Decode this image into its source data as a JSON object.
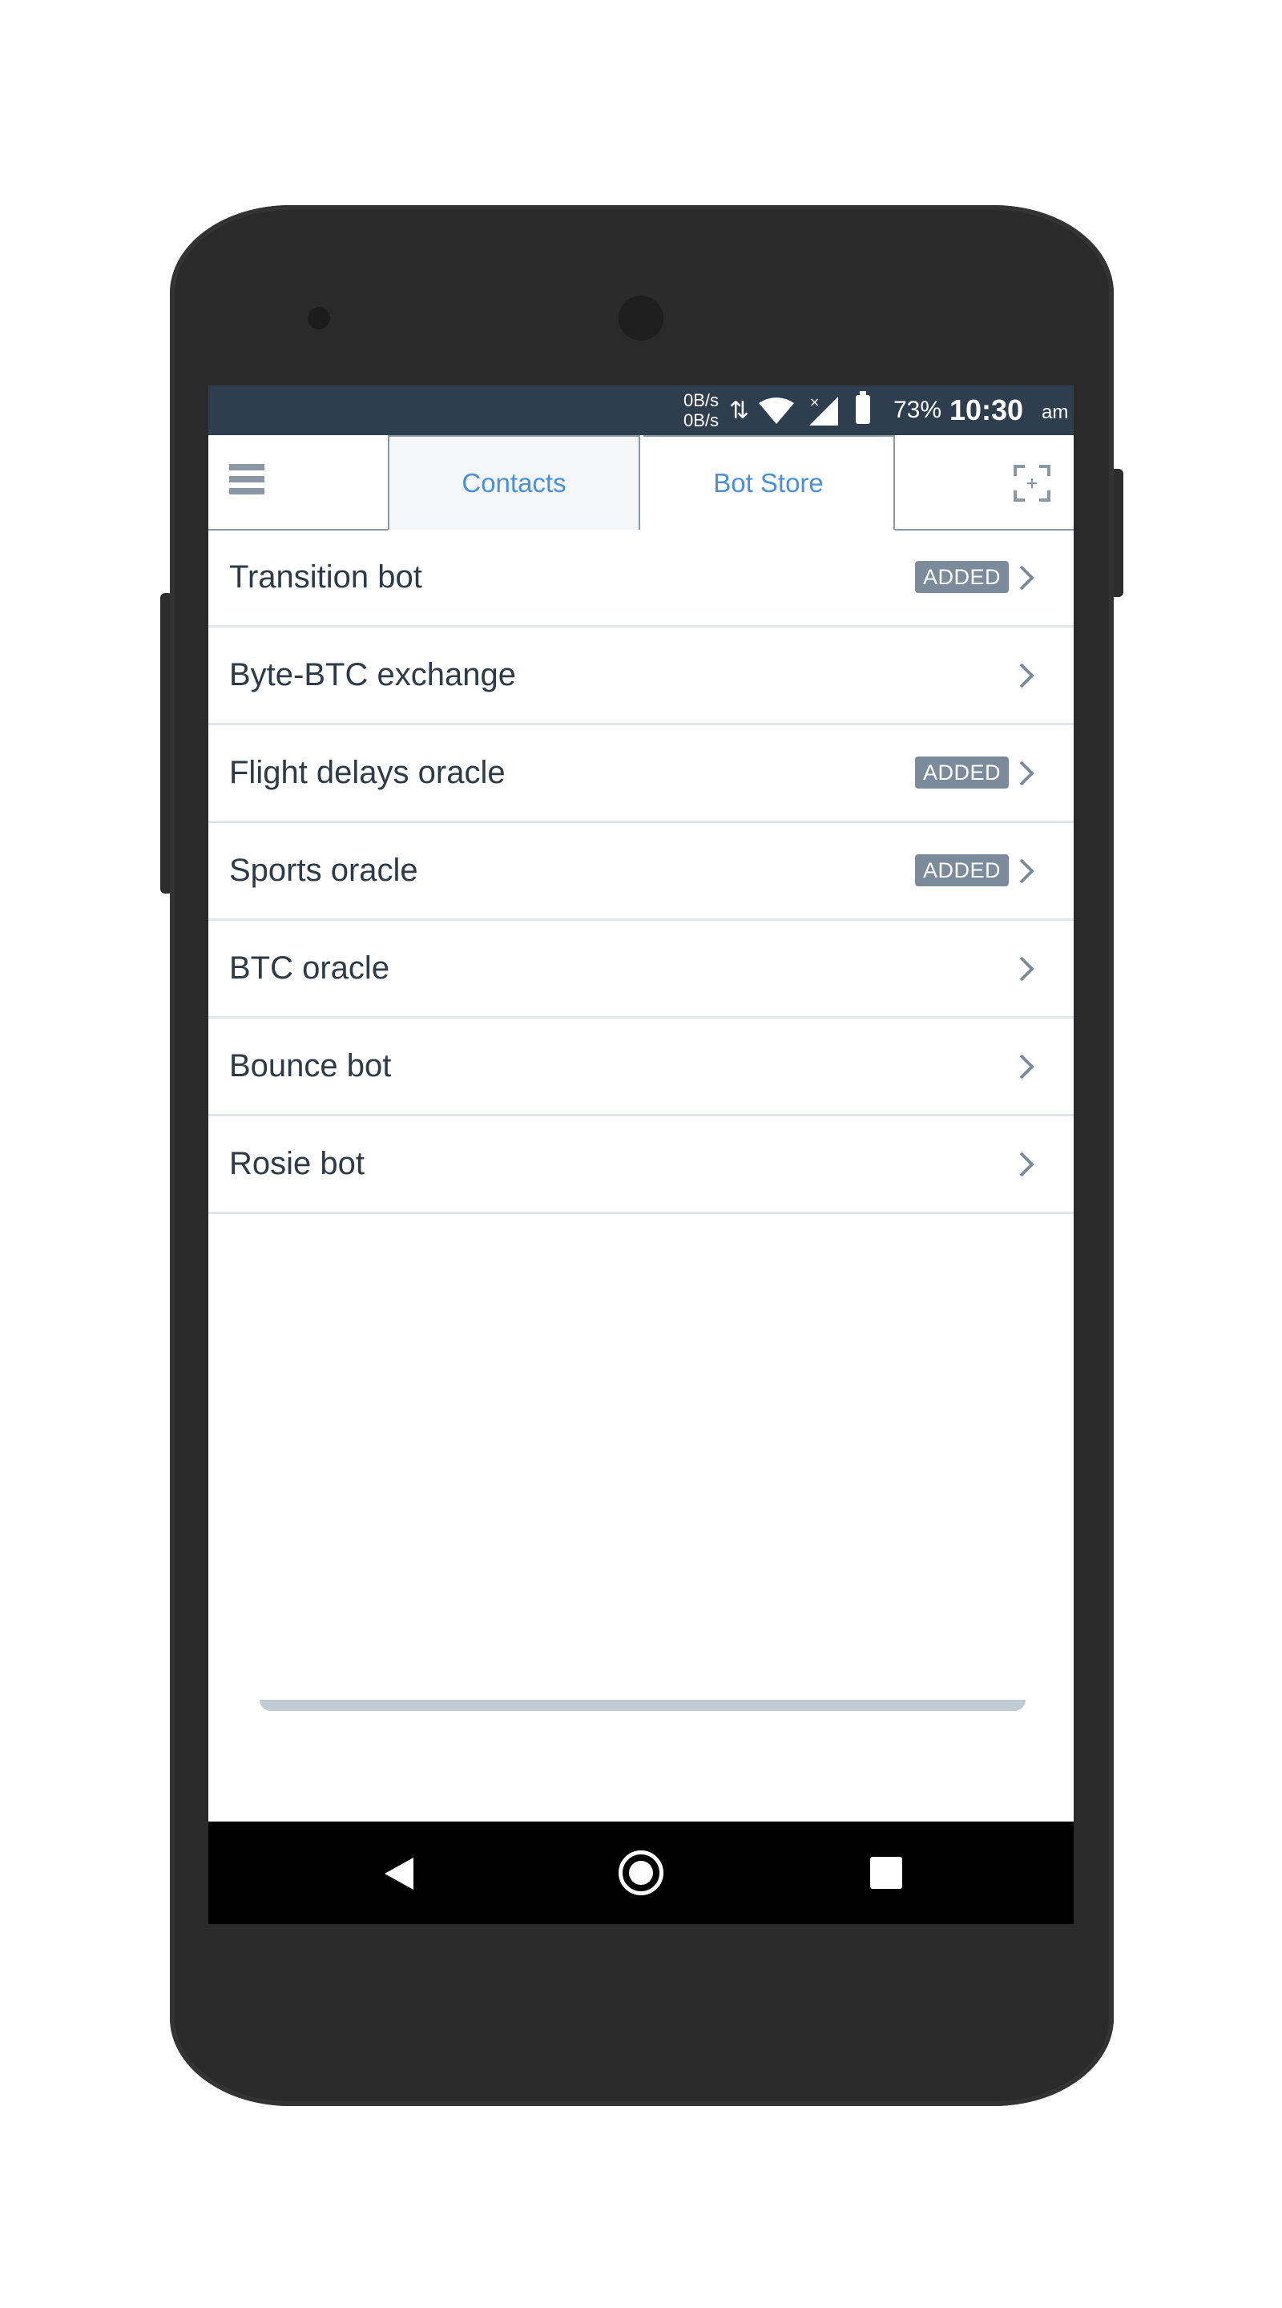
{
  "status_bar": {
    "speed_up": "0B/s",
    "speed_down": "0B/s",
    "battery_pct": "73%",
    "time": "10:30",
    "ampm": "am",
    "bg_color": "#2f3e4e"
  },
  "header": {
    "tabs": [
      {
        "label": "Contacts",
        "selected": false
      },
      {
        "label": "Bot Store",
        "selected": true
      }
    ],
    "accent_color": "#4a90d9"
  },
  "bots": [
    {
      "name": "Transition bot",
      "badge": "ADDED"
    },
    {
      "name": "Byte-BTC exchange",
      "badge": ""
    },
    {
      "name": "Flight delays oracle",
      "badge": "ADDED"
    },
    {
      "name": "Sports oracle",
      "badge": "ADDED"
    },
    {
      "name": "BTC oracle",
      "badge": ""
    },
    {
      "name": "Bounce bot",
      "badge": ""
    },
    {
      "name": "Rosie bot",
      "badge": ""
    }
  ],
  "icons": {
    "menu": "hamburger-icon",
    "scan": "scan-qr-icon",
    "chevron": "chevron-right-icon",
    "back": "back-triangle-icon",
    "home": "home-circle-icon",
    "recent": "recent-square-icon"
  }
}
